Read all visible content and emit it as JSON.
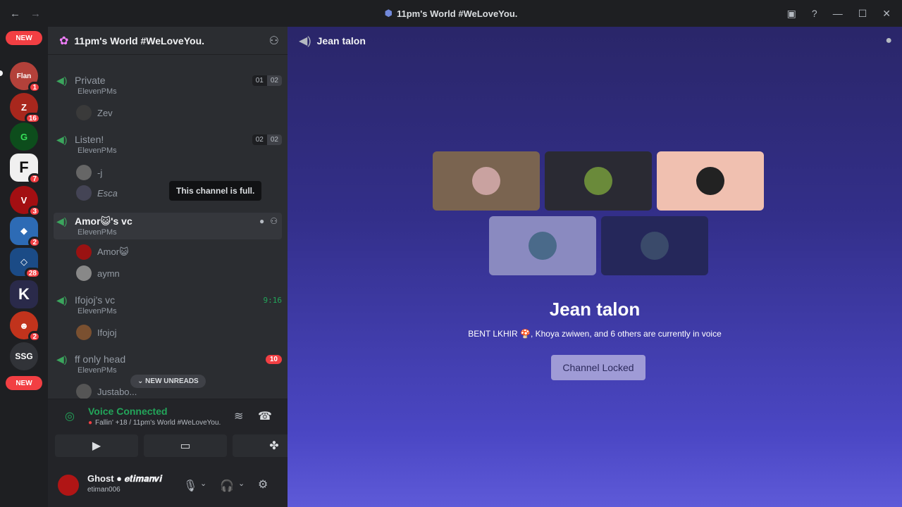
{
  "window": {
    "title": "11pm's World #WeLoveYou.",
    "back_glyph": "←",
    "forward_glyph": "→",
    "inbox_glyph": "▣",
    "help_glyph": "?",
    "minimize_glyph": "—",
    "maximize_glyph": "☐",
    "close_glyph": "✕"
  },
  "guilds": {
    "new_label": "NEW",
    "items": [
      {
        "text": "Flan",
        "badge": "1",
        "color": "#b3413a"
      },
      {
        "text": "Z",
        "badge": "16",
        "color": "#a8271d"
      },
      {
        "text": "G",
        "badge": "",
        "color": "#0d4d1c"
      },
      {
        "text": "F",
        "badge": "7",
        "color": "#f0f0f0"
      },
      {
        "text": "V",
        "badge": "3",
        "color": "#a30f12"
      },
      {
        "text": "◆",
        "badge": "2",
        "color": "#2d6bb5"
      },
      {
        "text": "◇",
        "badge": "28",
        "color": "#1b4b86"
      },
      {
        "text": "K",
        "badge": "",
        "color": "#2a2a4a"
      },
      {
        "text": "☻",
        "badge": "2",
        "color": "#c1331c"
      },
      {
        "text": "SSG",
        "badge": "",
        "color": "#313338"
      }
    ]
  },
  "sidebar": {
    "server_name": "11pm's World #WeLoveYou.",
    "channels": [
      {
        "name": "Private",
        "subtitle": "ElevenPMs",
        "limit_left": "01",
        "limit_right": "02"
      },
      {
        "name": "Listen!",
        "subtitle": "ElevenPMs",
        "limit_left": "02",
        "limit_right": "02"
      },
      {
        "name": "Amor😺's vc",
        "subtitle": "ElevenPMs"
      },
      {
        "name": "Ifojoj's vc",
        "subtitle": "ElevenPMs",
        "time": "9:16"
      },
      {
        "name": "ff only head",
        "subtitle": "ElevenPMs",
        "unread": "10"
      }
    ],
    "members": {
      "private": [
        "Zev"
      ],
      "listen": [
        "-j",
        "Esca"
      ],
      "amor": [
        "Amor😺",
        "aymn"
      ],
      "ifojoj": [
        "Ifojoj"
      ],
      "ff": [
        "Justabo..."
      ]
    },
    "tooltip": "This channel is full.",
    "new_unreads": "NEW UNREADS"
  },
  "voice_panel": {
    "status": "Voice Connected",
    "details": "Fallin' +18 / 11pm's World #WeLoveYou."
  },
  "user_panel": {
    "display_name": "Ghost ● 𝒆𝒕𝒊𝒎𝒂𝒏𝒗𝒊",
    "username": "etiman006"
  },
  "main": {
    "channel_title": "Jean talon",
    "heading": "Jean talon",
    "voice_text": "BENT LKHIR 🍄, Khoya zwiwen, and 6 others are currently in voice",
    "locked_button": "Channel Locked",
    "tiles": [
      "#7a6450",
      "#2a2a33",
      "#f0c0b0",
      "#8a8ac0",
      "#25275a"
    ]
  }
}
